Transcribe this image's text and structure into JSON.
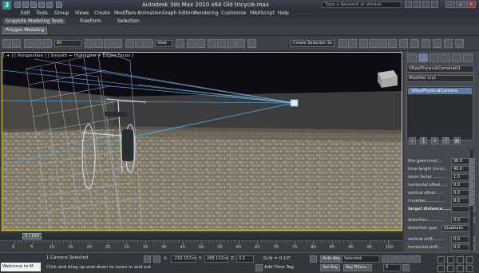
{
  "app": {
    "title": "Autodesk 3ds Max  2010 x64     Old tricycle.max",
    "search_placeholder": "Type a keyword or phrase",
    "logo_glyph": "3"
  },
  "menu": [
    "Edit",
    "Tools",
    "Group",
    "Views",
    "Create",
    "Modifiers",
    "Animation",
    "Graph Editors",
    "Rendering",
    "Customize",
    "MAXScript",
    "Help"
  ],
  "ribbon": {
    "tabs": [
      "Graphite Modeling Tools",
      "Freeform",
      "Selection"
    ],
    "sub_label": "Polygon Modeling"
  },
  "toolbar": {
    "filter": "All",
    "ref_coord": "View",
    "named_selection": "Create Selection Se"
  },
  "viewport": {
    "label": "[ + ] [ Perspective ] [ Smooth + Highlights + Edged Faces ]",
    "border_color": "#d8d040"
  },
  "command_panel": {
    "object_name": "VRayPhysicalCamera01",
    "modifier_list": "Modifier List",
    "stack_item": "VRayPhysicalCamera",
    "params": [
      {
        "label": "film gate (mm)...",
        "value": "36.0"
      },
      {
        "label": "focal length (mm)...",
        "value": "40.0"
      },
      {
        "label": "zoom factor .........",
        "value": "1.0"
      },
      {
        "label": "horizontal offset.....",
        "value": "0.0"
      },
      {
        "label": "vertical offset......",
        "value": "0.0"
      },
      {
        "label": "f-number................",
        "value": "8.0"
      },
      {
        "label": "target distance......",
        "value": "",
        "bold": true
      },
      {
        "label": "distortion.............",
        "value": "0.0"
      },
      {
        "label": "distortion type",
        "value": "Quadratic"
      },
      {
        "label": "vertical shift.........",
        "value": "0.0"
      },
      {
        "label": "horizontal shift......",
        "value": "0.0"
      }
    ]
  },
  "timeline": {
    "frame_label": "0 / 100",
    "ticks": [
      "0",
      "5",
      "10",
      "15",
      "20",
      "25",
      "30",
      "35",
      "40",
      "45",
      "50",
      "55",
      "60",
      "65",
      "70",
      "75",
      "80",
      "85",
      "90",
      "95",
      "100"
    ]
  },
  "status": {
    "maxscript": "Welcome to M",
    "selection": "1 Camera Selected",
    "prompt": "Click and drag up-and-down to zoom in and out",
    "x_label": "X:",
    "x_value": "-218.157cm",
    "y_label": "Y:",
    "y_value": "268.122cm",
    "z_label": "Z:",
    "z_value": "0.0",
    "grid": "Grid = 0.10\"",
    "add_time_tag": "Add Time Tag",
    "auto_key": "Auto Key",
    "set_key": "Set Key",
    "key_mode": "Selected",
    "key_filters": "Key Filters...",
    "frame": "0"
  }
}
